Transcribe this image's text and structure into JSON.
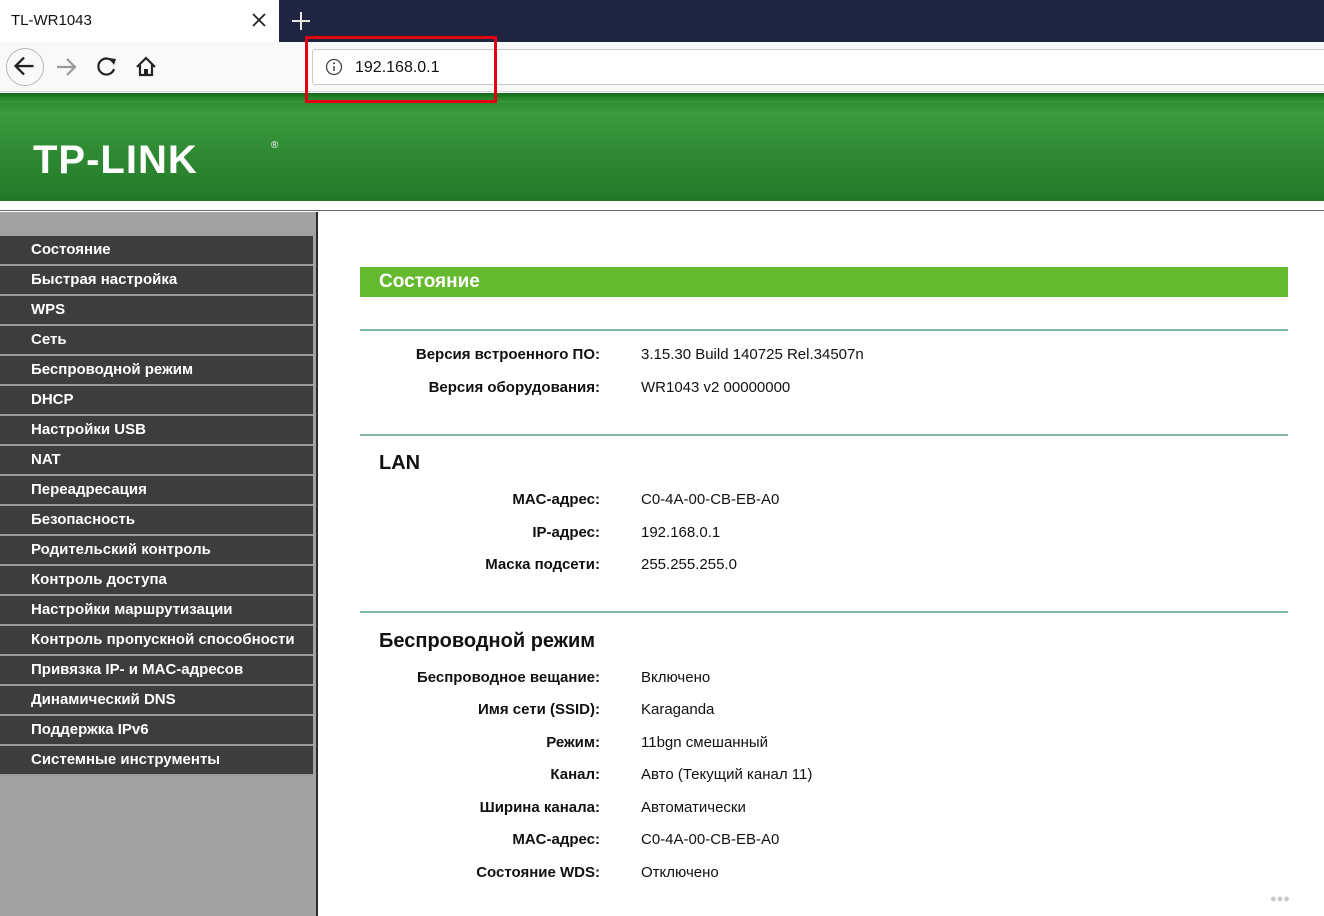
{
  "browser": {
    "tab_title": "TL-WR1043",
    "url": "192.168.0.1"
  },
  "router": {
    "logo": "TP-LINK",
    "logo_mark": "®"
  },
  "sidebar": {
    "items": [
      {
        "label": "Состояние"
      },
      {
        "label": "Быстрая настройка"
      },
      {
        "label": "WPS"
      },
      {
        "label": "Сеть"
      },
      {
        "label": "Беспроводной режим"
      },
      {
        "label": "DHCP"
      },
      {
        "label": "Настройки USB"
      },
      {
        "label": "NAT"
      },
      {
        "label": "Переадресация"
      },
      {
        "label": "Безопасность"
      },
      {
        "label": "Родительский контроль"
      },
      {
        "label": "Контроль доступа"
      },
      {
        "label": "Настройки маршрутизации"
      },
      {
        "label": "Контроль пропускной способности"
      },
      {
        "label": "Привязка IP- и MAC-адресов"
      },
      {
        "label": "Динамический DNS"
      },
      {
        "label": "Поддержка IPv6"
      },
      {
        "label": "Системные инструменты"
      }
    ]
  },
  "main": {
    "title": "Состояние",
    "firmware": {
      "fw_label": "Версия встроенного ПО:",
      "fw_value": "3.15.30 Build 140725 Rel.34507n",
      "hw_label": "Версия оборудования:",
      "hw_value": "WR1043 v2 00000000"
    },
    "lan": {
      "title": "LAN",
      "mac_label": "MAC-адрес:",
      "mac_value": "C0-4A-00-CB-EB-A0",
      "ip_label": "IP-адрес:",
      "ip_value": "192.168.0.1",
      "mask_label": "Маска подсети:",
      "mask_value": "255.255.255.0"
    },
    "wireless": {
      "title": "Беспроводной режим",
      "broadcast_label": "Беспроводное вещание:",
      "broadcast_value": "Включено",
      "ssid_label": "Имя сети (SSID):",
      "ssid_value": "Karaganda",
      "mode_label": "Режим:",
      "mode_value": "11bgn смешанный",
      "channel_label": "Канал:",
      "channel_value": "Авто (Текущий канал 11)",
      "width_label": "Ширина канала:",
      "width_value": "Автоматически",
      "mac_label": "MAC-адрес:",
      "mac_value": "C0-4A-00-CB-EB-A0",
      "wds_label": "Состояние WDS:",
      "wds_value": "Отключено"
    }
  },
  "watermark": "●●●",
  "colors": {
    "tabstrip": "#1f2540",
    "header_green": "#2f8a33",
    "title_bar": "#64b92e",
    "menu_bg": "#3d3d3d",
    "highlight": "#e00012"
  }
}
